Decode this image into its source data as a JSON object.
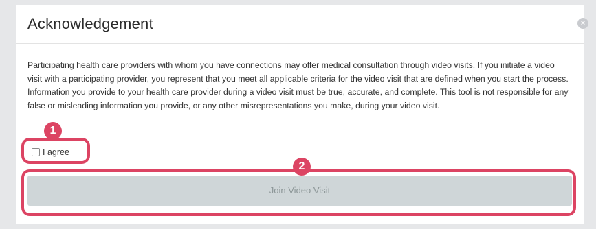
{
  "dialog": {
    "title": "Acknowledgement",
    "close_icon": "×",
    "body": "Participating health care providers with whom you have connections may offer medical consultation through video visits. If you initiate a video visit with a participating provider, you represent that you meet all applicable criteria for the video visit that are defined when you start the process. Information you provide to your health care provider during a video visit must be true, accurate, and complete. This tool is not responsible for any false or misleading information you provide, or any other misrepresentations you make, during your video visit.",
    "agree_label": "I agree",
    "agree_checked": false,
    "join_button_label": "Join Video Visit",
    "join_button_enabled": false
  },
  "annotations": [
    {
      "number": "1"
    },
    {
      "number": "2"
    }
  ],
  "colors": {
    "highlight": "#dc4463",
    "button_disabled_bg": "#cfd6d8",
    "background": "#e6e7e9"
  }
}
